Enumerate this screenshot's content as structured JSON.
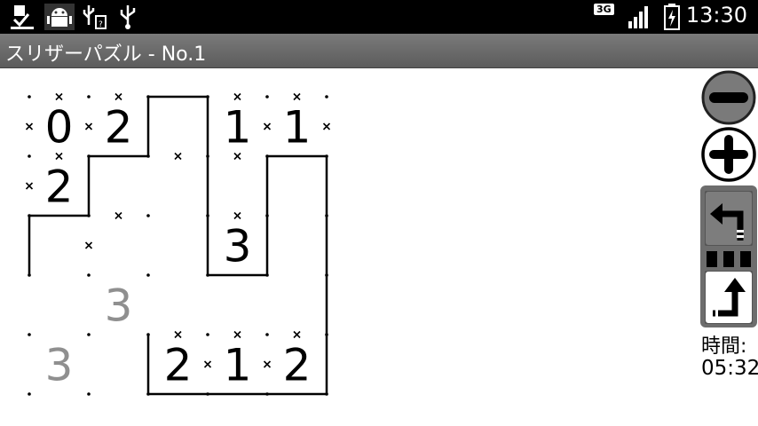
{
  "status_bar": {
    "time": "13:30",
    "network": "3G",
    "icons": [
      "download-done-icon",
      "android-debug-icon",
      "usb-sd-icon",
      "usb-icon",
      "signal-icon",
      "battery-charging-icon"
    ]
  },
  "app": {
    "title": "スリザーパズル - No.1"
  },
  "puzzle": {
    "rows": 5,
    "cols": 5,
    "clues": [
      {
        "r": 0,
        "c": 0,
        "v": "0",
        "given": true
      },
      {
        "r": 0,
        "c": 1,
        "v": "2",
        "given": true
      },
      {
        "r": 0,
        "c": 3,
        "v": "1",
        "given": true
      },
      {
        "r": 0,
        "c": 4,
        "v": "1",
        "given": true
      },
      {
        "r": 1,
        "c": 0,
        "v": "2",
        "given": true
      },
      {
        "r": 2,
        "c": 3,
        "v": "3",
        "given": true
      },
      {
        "r": 3,
        "c": 1,
        "v": "3",
        "given": false
      },
      {
        "r": 4,
        "c": 0,
        "v": "3",
        "given": false
      },
      {
        "r": 4,
        "c": 2,
        "v": "2",
        "given": true
      },
      {
        "r": 4,
        "c": 3,
        "v": "1",
        "given": true
      },
      {
        "r": 4,
        "c": 4,
        "v": "2",
        "given": true
      }
    ],
    "lines": [
      {
        "o": "h",
        "r": 0,
        "c": 2
      },
      {
        "o": "v",
        "r": 0,
        "c": 2
      },
      {
        "o": "v",
        "r": 0,
        "c": 3
      },
      {
        "o": "h",
        "r": 1,
        "c": 1
      },
      {
        "o": "v",
        "r": 1,
        "c": 1
      },
      {
        "o": "v",
        "r": 1,
        "c": 3
      },
      {
        "o": "h",
        "r": 1,
        "c": 4
      },
      {
        "o": "v",
        "r": 1,
        "c": 4
      },
      {
        "o": "v",
        "r": 1,
        "c": 5
      },
      {
        "o": "h",
        "r": 2,
        "c": 0
      },
      {
        "o": "v",
        "r": 2,
        "c": 0
      },
      {
        "o": "v",
        "r": 2,
        "c": 3
      },
      {
        "o": "v",
        "r": 2,
        "c": 4
      },
      {
        "o": "v",
        "r": 2,
        "c": 5
      },
      {
        "o": "h",
        "r": 3,
        "c": 3
      },
      {
        "o": "v",
        "r": 3,
        "c": 5
      },
      {
        "o": "v",
        "r": 4,
        "c": 2
      },
      {
        "o": "v",
        "r": 4,
        "c": 5
      },
      {
        "o": "h",
        "r": 5,
        "c": 2
      },
      {
        "o": "h",
        "r": 5,
        "c": 3
      },
      {
        "o": "h",
        "r": 5,
        "c": 4
      }
    ],
    "crosses": [
      {
        "o": "h",
        "r": 0,
        "c": 0
      },
      {
        "o": "h",
        "r": 0,
        "c": 1
      },
      {
        "o": "h",
        "r": 0,
        "c": 3
      },
      {
        "o": "h",
        "r": 0,
        "c": 4
      },
      {
        "o": "v",
        "r": 0,
        "c": 0
      },
      {
        "o": "v",
        "r": 0,
        "c": 1
      },
      {
        "o": "v",
        "r": 0,
        "c": 4
      },
      {
        "o": "v",
        "r": 0,
        "c": 5
      },
      {
        "o": "h",
        "r": 1,
        "c": 0
      },
      {
        "o": "h",
        "r": 1,
        "c": 2
      },
      {
        "o": "h",
        "r": 1,
        "c": 3
      },
      {
        "o": "v",
        "r": 1,
        "c": 0
      },
      {
        "o": "h",
        "r": 2,
        "c": 1
      },
      {
        "o": "h",
        "r": 2,
        "c": 3
      },
      {
        "o": "v",
        "r": 2,
        "c": 1
      },
      {
        "o": "h",
        "r": 4,
        "c": 2
      },
      {
        "o": "h",
        "r": 4,
        "c": 3
      },
      {
        "o": "h",
        "r": 4,
        "c": 4
      },
      {
        "o": "v",
        "r": 4,
        "c": 3
      },
      {
        "o": "v",
        "r": 4,
        "c": 4
      }
    ]
  },
  "controls": {
    "zoom_out_icon": "minus-circle-icon",
    "zoom_in_icon": "plus-circle-icon",
    "undo_icon": "undo-arrow-icon",
    "redo_icon": "redo-arrow-icon"
  },
  "timer": {
    "label": "時間:",
    "value": "05:32"
  }
}
